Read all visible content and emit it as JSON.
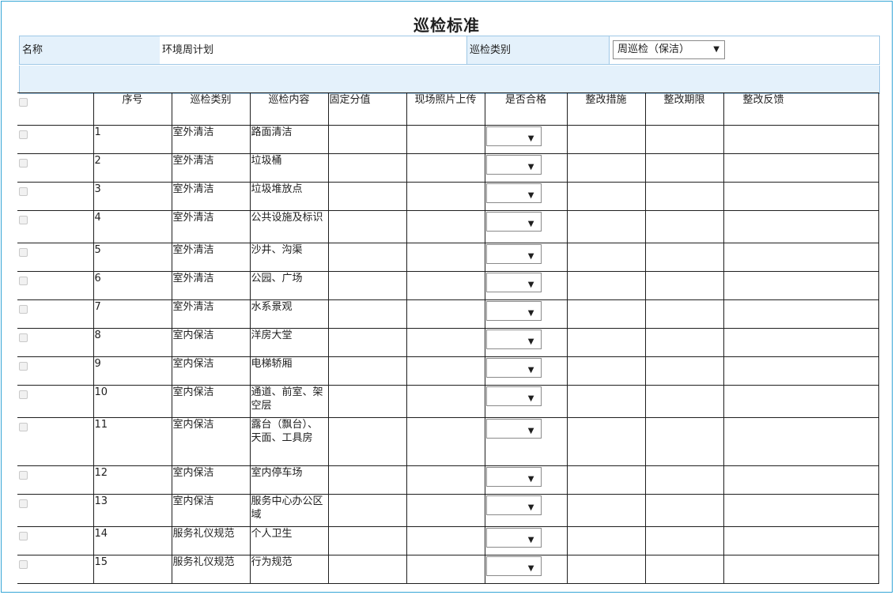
{
  "page": {
    "title": "巡检标准"
  },
  "info": {
    "name_label": "名称",
    "name_value": "环境周计划",
    "category_label": "巡检类别",
    "category_value": "周巡检（保洁）"
  },
  "icons": {
    "dropdown": "▼"
  },
  "table": {
    "headers": {
      "index": "序号",
      "category": "巡检类别",
      "content": "巡检内容",
      "score": "固定分值",
      "photo": "现场照片上传",
      "qualified": "是否合格",
      "measures": "整改措施",
      "deadline": "整改期限",
      "feedback": "整改反馈"
    },
    "rows": [
      {
        "index": "1",
        "category": "室外清洁",
        "content": "路面清洁"
      },
      {
        "index": "2",
        "category": "室外清洁",
        "content": "垃圾桶"
      },
      {
        "index": "3",
        "category": "室外清洁",
        "content": "垃圾堆放点"
      },
      {
        "index": "4",
        "category": "室外清洁",
        "content": "公共设施及标识"
      },
      {
        "index": "5",
        "category": "室外清洁",
        "content": "沙井、沟渠"
      },
      {
        "index": "6",
        "category": "室外清洁",
        "content": "公园、广场"
      },
      {
        "index": "7",
        "category": "室外清洁",
        "content": "水系景观"
      },
      {
        "index": "8",
        "category": "室内保洁",
        "content": "洋房大堂"
      },
      {
        "index": "9",
        "category": "室内保洁",
        "content": "电梯轿厢"
      },
      {
        "index": "10",
        "category": "室内保洁",
        "content": "通道、前室、架空层"
      },
      {
        "index": "11",
        "category": "室内保洁",
        "content": "露台（飘台）、天面、工具房"
      },
      {
        "index": "12",
        "category": "室内保洁",
        "content": "室内停车场"
      },
      {
        "index": "13",
        "category": "室内保洁",
        "content": "服务中心办公区域"
      },
      {
        "index": "14",
        "category": "服务礼仪规范",
        "content": "个人卫生"
      },
      {
        "index": "15",
        "category": "服务礼仪规范",
        "content": "行为规范"
      }
    ]
  }
}
